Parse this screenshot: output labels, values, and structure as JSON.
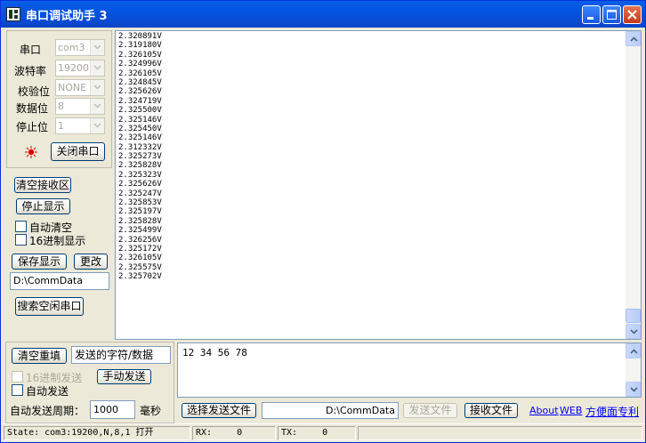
{
  "window": {
    "title": "串口调试助手 3"
  },
  "port_settings": {
    "port_label": "串口",
    "port_value": "com3",
    "baud_label": "波特率",
    "baud_value": "19200",
    "parity_label": "校验位",
    "parity_value": "NONE",
    "databits_label": "数据位",
    "databits_value": "8",
    "stopbits_label": "停止位",
    "stopbits_value": "1",
    "toggle_port_button": "关闭串口",
    "indicator_color": "#e00000"
  },
  "receive_controls": {
    "clear_receive_button": "清空接收区",
    "stop_display_button": "停止显示",
    "auto_clear_label": "自动清空",
    "hex_display_label": "16进制显示",
    "save_display_button": "保存显示",
    "change_button": "更改",
    "save_path": "D:\\CommData",
    "search_ports_button": "搜索空闲串口"
  },
  "receive_area": {
    "lines": [
      "2.320891V",
      "2.319180V",
      "2.326105V",
      "2.324996V",
      "2.326105V",
      "2.324845V",
      "2.325626V",
      "2.324719V",
      "2.325500V",
      "2.325146V",
      "2.325450V",
      "2.325146V",
      "2.312332V",
      "2.325273V",
      "2.325828V",
      "2.325323V",
      "2.325626V",
      "2.325247V",
      "2.325853V",
      "2.325197V",
      "2.325828V",
      "2.325499V",
      "2.326256V",
      "2.325172V",
      "2.326105V",
      "2.325575V",
      "2.325702V"
    ]
  },
  "send_controls": {
    "clear_reset_button": "清空重填",
    "send_label": "发送的字符/数据",
    "hex_send_label": "16进制发送",
    "manual_send_button": "手动发送",
    "auto_send_label": "自动发送",
    "period_label": "自动发送周期：",
    "period_value": "1000",
    "period_unit": "毫秒",
    "send_text": "12 34 56 78",
    "select_file_button": "选择发送文件",
    "file_path": "D:\\CommData",
    "send_file_button": "发送文件",
    "receive_file_button": "接收文件",
    "about_link": "About",
    "web_link": "WEB",
    "brand_link": "方便面专利"
  },
  "status_bar": {
    "state": "State: com3:19200,N,8,1 打开",
    "rx_label": "RX:",
    "rx_value": "0",
    "tx_label": "TX:",
    "tx_value": "0"
  }
}
